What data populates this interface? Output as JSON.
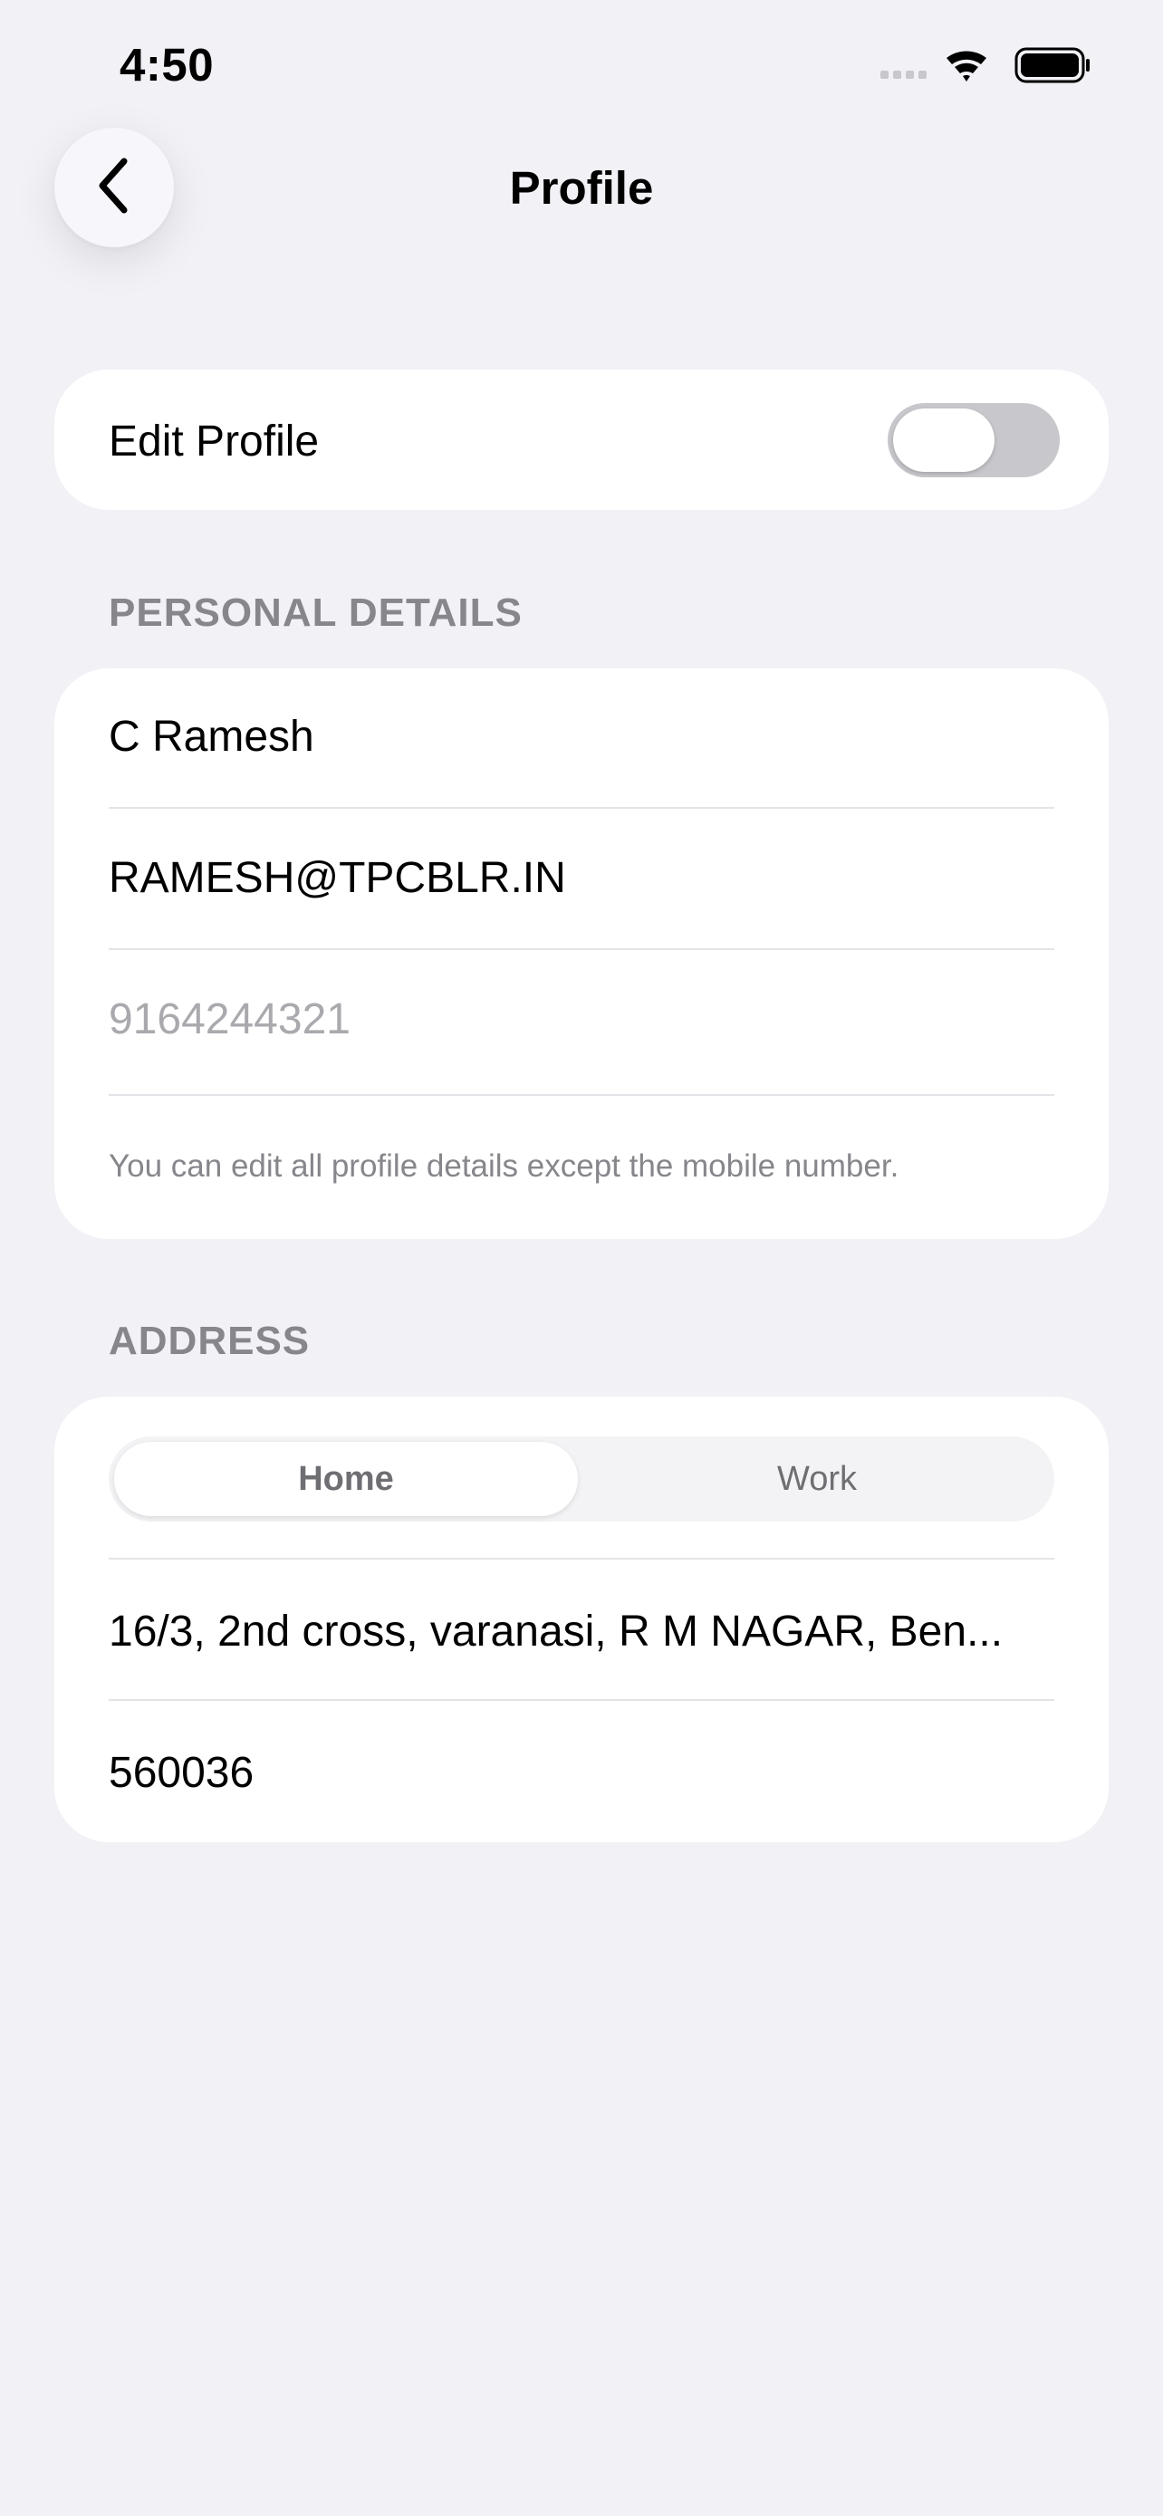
{
  "status_bar": {
    "time": "4:50",
    "icons": [
      "signal-icon",
      "wifi-icon",
      "battery-icon"
    ]
  },
  "header": {
    "title": "Profile",
    "back_icon": "chevron-left-icon"
  },
  "edit_profile": {
    "label": "Edit Profile",
    "toggle_on": false
  },
  "personal_details": {
    "section_title": "PERSONAL DETAILS",
    "name": "C Ramesh",
    "email": "RAMESH@TPCBLR.IN",
    "mobile": "9164244321",
    "hint": "You can edit all profile details except the mobile number."
  },
  "address": {
    "section_title": "ADDRESS",
    "tabs": [
      {
        "label": "Home",
        "selected": true
      },
      {
        "label": "Work",
        "selected": false
      }
    ],
    "street": "16/3, 2nd cross, varanasi, R M NAGAR, Ben...",
    "pincode": "560036"
  },
  "colors": {
    "background": "#f1f1f6",
    "card": "#ffffff",
    "secondary_text": "#86868b",
    "toggle_off": "#c7c7cc"
  }
}
